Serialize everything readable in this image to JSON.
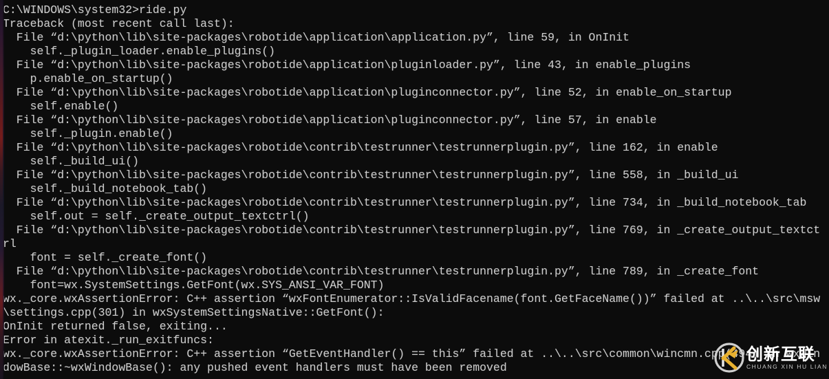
{
  "terminal": {
    "window_title": "C:\\WINDOWS\\system32",
    "background_color": "#0c0c0c",
    "foreground_color": "#cccccc",
    "lines": [
      "C:\\WINDOWS\\system32>ride.py",
      "Traceback (most recent call last):",
      "  File “d:\\python\\lib\\site-packages\\robotide\\application\\application.py”, line 59, in OnInit",
      "    self._plugin_loader.enable_plugins()",
      "  File “d:\\python\\lib\\site-packages\\robotide\\application\\pluginloader.py”, line 43, in enable_plugins",
      "    p.enable_on_startup()",
      "  File “d:\\python\\lib\\site-packages\\robotide\\application\\pluginconnector.py”, line 52, in enable_on_startup",
      "    self.enable()",
      "  File “d:\\python\\lib\\site-packages\\robotide\\application\\pluginconnector.py”, line 57, in enable",
      "    self._plugin.enable()",
      "  File “d:\\python\\lib\\site-packages\\robotide\\contrib\\testrunner\\testrunnerplugin.py”, line 162, in enable",
      "    self._build_ui()",
      "  File “d:\\python\\lib\\site-packages\\robotide\\contrib\\testrunner\\testrunnerplugin.py”, line 558, in _build_ui",
      "    self._build_notebook_tab()",
      "  File “d:\\python\\lib\\site-packages\\robotide\\contrib\\testrunner\\testrunnerplugin.py”, line 734, in _build_notebook_tab",
      "    self.out = self._create_output_textctrl()",
      "  File “d:\\python\\lib\\site-packages\\robotide\\contrib\\testrunner\\testrunnerplugin.py”, line 769, in _create_output_textct",
      "rl",
      "    font = self._create_font()",
      "  File “d:\\python\\lib\\site-packages\\robotide\\contrib\\testrunner\\testrunnerplugin.py”, line 789, in _create_font",
      "    font=wx.SystemSettings.GetFont(wx.SYS_ANSI_VAR_FONT)",
      "wx._core.wxAssertionError: C++ assertion “wxFontEnumerator::IsValidFacename(font.GetFaceName())” failed at ..\\..\\src\\msw",
      "\\settings.cpp(301) in wxSystemSettingsNative::GetFont():",
      "OnInit returned false, exiting...",
      "Error in atexit._run_exitfuncs:",
      "wx._core.wxAssertionError: C++ assertion “GetEventHandler() == this” failed at ..\\..\\src\\common\\wincmn.cpp(494) in wxWin",
      "dowBase::~wxWindowBase(): any pushed event handlers must have been removed"
    ]
  },
  "watermark": {
    "logo_icon": "circle-k-logo-icon",
    "chinese_text": "创新互联",
    "pinyin_text": "CHUANG XIN HU LIAN",
    "accent_color": "#e8b130"
  }
}
